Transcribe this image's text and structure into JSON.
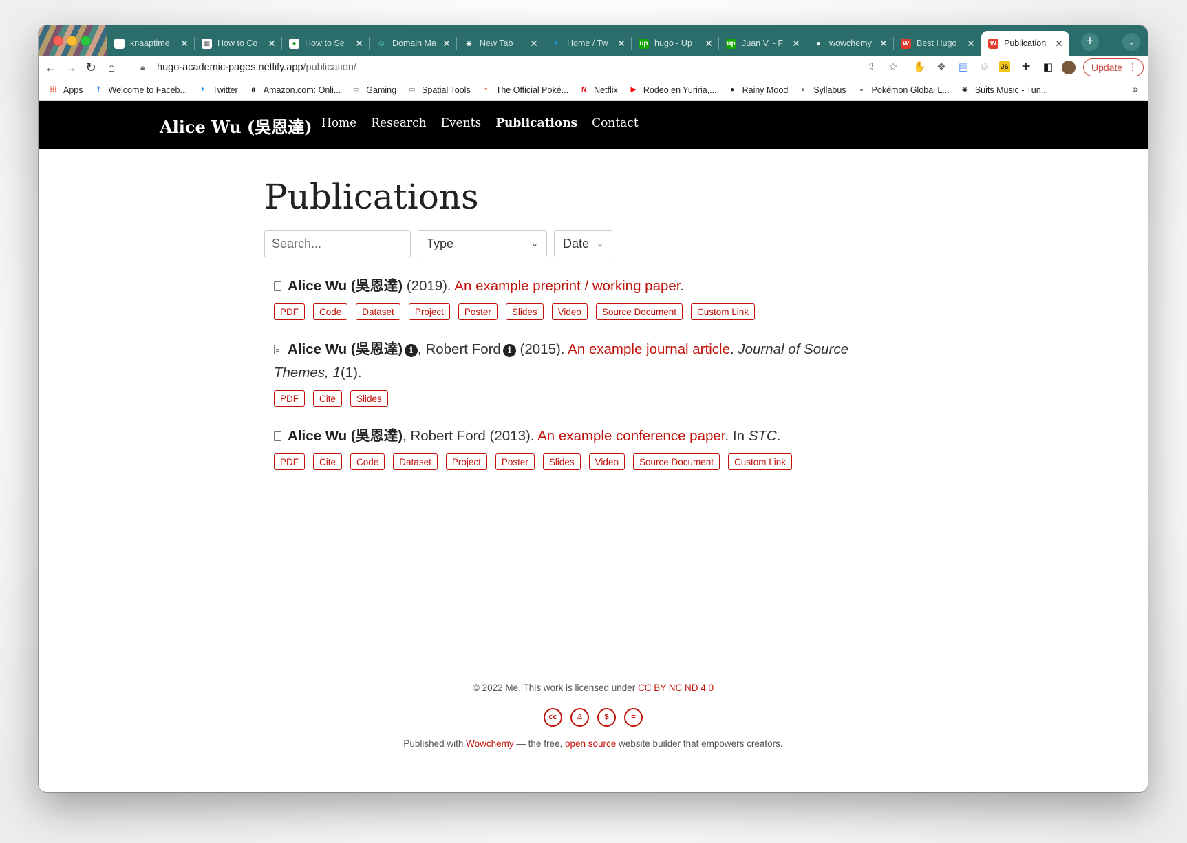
{
  "browser": {
    "tabs": [
      {
        "title": "knaaptime",
        "fav": "",
        "favColor": "#ffffff",
        "favText": "#000"
      },
      {
        "title": "How to Co",
        "fav": "▦",
        "favColor": "#ffffff",
        "favText": "#555"
      },
      {
        "title": "How to Se",
        "fav": "●",
        "favColor": "#ffffff",
        "favText": "#23a323"
      },
      {
        "title": "Domain Ma",
        "fav": "◎",
        "favColor": "#2b6d6a",
        "favText": "#5ed0c9"
      },
      {
        "title": "New Tab",
        "fav": "◉",
        "favColor": "#2b6d6a",
        "favText": "#ffffff"
      },
      {
        "title": "Home / Tw",
        "fav": "✦",
        "favColor": "#2b6d6a",
        "favText": "#1d9bf0"
      },
      {
        "title": "hugo - Up",
        "fav": "up",
        "favColor": "#14a800",
        "favText": "#ffffff"
      },
      {
        "title": "Juan V. - F",
        "fav": "up",
        "favColor": "#14a800",
        "favText": "#ffffff"
      },
      {
        "title": "wowchemy",
        "fav": "●",
        "favColor": "#2b6d6a",
        "favText": "#ffffff"
      },
      {
        "title": "Best Hugo",
        "fav": "W",
        "favColor": "#e43d30",
        "favText": "#ffffff"
      },
      {
        "title": "Publication",
        "fav": "W",
        "favColor": "#e43d30",
        "favText": "#ffffff",
        "active": true
      }
    ],
    "url_host": "hugo-academic-pages.netlify.app",
    "url_path": "/publication/",
    "update_label": "Update",
    "bookmarks": [
      {
        "label": "Apps",
        "icon": "⁞⁞⁞",
        "iconColor": "#e24a2d"
      },
      {
        "label": "Welcome to Faceb...",
        "icon": "f",
        "iconColor": "#1877f2"
      },
      {
        "label": "Twitter",
        "icon": "✦",
        "iconColor": "#1d9bf0"
      },
      {
        "label": "Amazon.com: Onli...",
        "icon": "a",
        "iconColor": "#111111"
      },
      {
        "label": "Gaming",
        "icon": "▭",
        "iconColor": "#555555"
      },
      {
        "label": "Spatial Tools",
        "icon": "▭",
        "iconColor": "#555555"
      },
      {
        "label": "The Official Poké...",
        "icon": "◓",
        "iconColor": "#e3350d"
      },
      {
        "label": "Netflix",
        "icon": "N",
        "iconColor": "#e50914"
      },
      {
        "label": "Rodeo en Yuriria,...",
        "icon": "▶",
        "iconColor": "#ff0000"
      },
      {
        "label": "Rainy Mood",
        "icon": "●",
        "iconColor": "#222222"
      },
      {
        "label": "Syllabus",
        "icon": "◐",
        "iconColor": "#666666"
      },
      {
        "label": "Pokémon Global L...",
        "icon": "◒",
        "iconColor": "#777777"
      },
      {
        "label": "Suits Music - Tun...",
        "icon": "◉",
        "iconColor": "#222222"
      }
    ]
  },
  "site": {
    "brand": "Alice Wu (吳恩達)",
    "nav": [
      "Home",
      "Research",
      "Events",
      "Publications",
      "Contact"
    ],
    "active_nav": "Publications",
    "page_title": "Publications",
    "search_placeholder": "Search...",
    "type_filter": "Type",
    "date_filter": "Date",
    "publications": [
      {
        "authors": [
          {
            "name": "Alice Wu (吳恩達)",
            "bold": true,
            "info": false
          }
        ],
        "year": "(2019).",
        "title": "An example preprint / working paper",
        "venue_prefix": "",
        "venue": "",
        "venue_suffix": "",
        "buttons": [
          "PDF",
          "Code",
          "Dataset",
          "Project",
          "Poster",
          "Slides",
          "Video",
          "Source Document",
          "Custom Link"
        ]
      },
      {
        "authors": [
          {
            "name": "Alice Wu (吳恩達)",
            "bold": true,
            "info": true
          },
          {
            "name": "Robert Ford",
            "bold": false,
            "info": true
          }
        ],
        "year": "(2015).",
        "title": "An example journal article",
        "venue_prefix": "",
        "venue": "Journal of Source Themes, 1",
        "venue_suffix": "(1).",
        "buttons": [
          "PDF",
          "Cite",
          "Slides"
        ]
      },
      {
        "authors": [
          {
            "name": "Alice Wu (吳恩達)",
            "bold": true,
            "info": false
          },
          {
            "name": "Robert Ford",
            "bold": false,
            "info": false
          }
        ],
        "year": "(2013).",
        "title": "An example conference paper",
        "venue_prefix": "In ",
        "venue": "STC",
        "venue_suffix": ".",
        "buttons": [
          "PDF",
          "Cite",
          "Code",
          "Dataset",
          "Project",
          "Poster",
          "Slides",
          "Video",
          "Source Document",
          "Custom Link"
        ]
      }
    ],
    "footer": {
      "copyright": "© 2022 Me. This work is licensed under ",
      "license": "CC BY NC ND 4.0",
      "cc_icons": [
        "cc",
        "by",
        "nc",
        "nd"
      ],
      "published_prefix": "Published with ",
      "wowchemy": "Wowchemy",
      "published_middle": " — the free, ",
      "open_source": "open source",
      "published_suffix": " website builder that empowers creators."
    }
  }
}
